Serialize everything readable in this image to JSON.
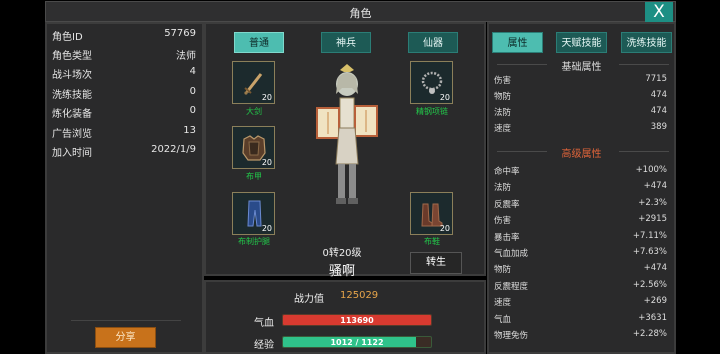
{
  "title": "角色",
  "close_label": "X",
  "left": {
    "rows": [
      {
        "label": "角色ID",
        "value": "57769"
      },
      {
        "label": "角色类型",
        "value": "法师"
      },
      {
        "label": "战斗场次",
        "value": "4"
      },
      {
        "label": "洗练技能",
        "value": "0"
      },
      {
        "label": "炼化装备",
        "value": "0"
      },
      {
        "label": "广告浏览",
        "value": "13"
      },
      {
        "label": "加入时间",
        "value": "2022/1/9"
      }
    ],
    "share_label": "分享"
  },
  "center": {
    "tabs": [
      "普通",
      "神兵",
      "仙器"
    ],
    "active_tab": "普通",
    "slots": {
      "weapon": {
        "name": "大剑",
        "level": "20",
        "icon": "sword-icon"
      },
      "armor": {
        "name": "布甲",
        "level": "20",
        "icon": "armor-icon"
      },
      "pants": {
        "name": "布制护腿",
        "level": "20",
        "icon": "pants-icon"
      },
      "necklace": {
        "name": "精钢项链",
        "level": "20",
        "icon": "necklace-icon"
      },
      "boots": {
        "name": "布鞋",
        "level": "20",
        "icon": "boots-icon"
      }
    },
    "level_text": "0转20级",
    "character_name": "骚啊",
    "rebirth_label": "转生"
  },
  "bottom": {
    "power_label": "战力值",
    "power_value": "125029",
    "hp_label": "气血",
    "hp_text": "113690",
    "hp_fraction": 1.0,
    "exp_label": "经验",
    "exp_text": "1012 / 1122",
    "exp_fraction": 0.902,
    "colors": {
      "hp": "#d83a30",
      "exp": "#2fc28a"
    }
  },
  "right": {
    "tabs": [
      "属性",
      "天赋技能",
      "洗练技能"
    ],
    "active_tab": "属性",
    "basic_title": "基础属性",
    "basic": [
      {
        "label": "伤害",
        "value": "7715"
      },
      {
        "label": "物防",
        "value": "474"
      },
      {
        "label": "法防",
        "value": "474"
      },
      {
        "label": "速度",
        "value": "389"
      }
    ],
    "advanced_title": "高级属性",
    "advanced": [
      {
        "label": "命中率",
        "value": "+100%"
      },
      {
        "label": "法防",
        "value": "+474"
      },
      {
        "label": "反震率",
        "value": "+2.3%"
      },
      {
        "label": "伤害",
        "value": "+2915"
      },
      {
        "label": "暴击率",
        "value": "+7.11%"
      },
      {
        "label": "气血加成",
        "value": "+7.63%"
      },
      {
        "label": "物防",
        "value": "+474"
      },
      {
        "label": "反震程度",
        "value": "+2.56%"
      },
      {
        "label": "速度",
        "value": "+269"
      },
      {
        "label": "气血",
        "value": "+3631"
      },
      {
        "label": "物理免伤",
        "value": "+2.28%"
      }
    ],
    "colors": {
      "basic_title": "#dcdcdc",
      "advanced_title": "#e0643a"
    }
  }
}
